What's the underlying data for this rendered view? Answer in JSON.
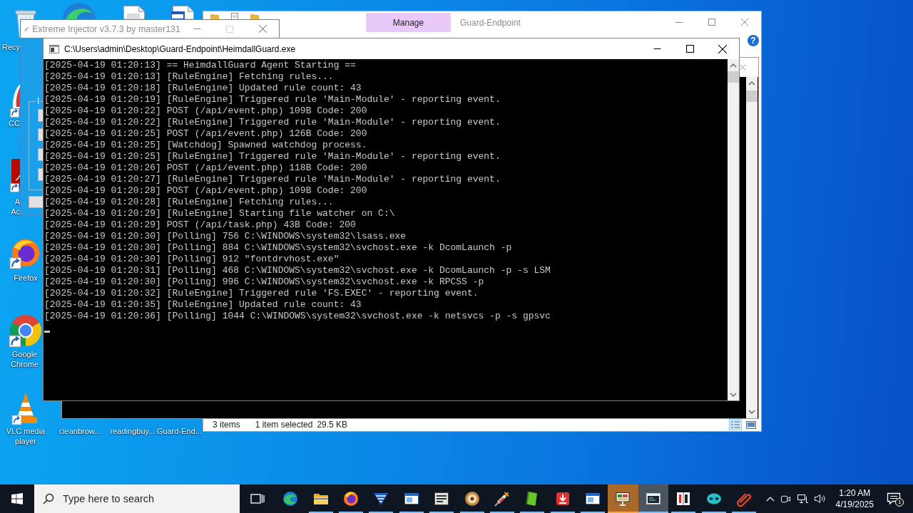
{
  "desktop_icons": [
    {
      "kind": "recycle-bin",
      "label": "Recy"
    },
    {
      "kind": "wave-browser"
    },
    {
      "kind": "document"
    },
    {
      "kind": "document-window"
    },
    {
      "kind": "cloud-app",
      "label": "CC"
    },
    {
      "kind": "pdf-app",
      "label": "A Ac"
    },
    {
      "kind": "fox-browser",
      "label": "Firefox"
    },
    {
      "kind": "ring-browser",
      "label": "Google Chrome"
    },
    {
      "kind": "cone",
      "label": "VLC media player"
    },
    {
      "kind": "covered",
      "label": "cleanbrow..."
    },
    {
      "kind": "covered",
      "label": "readingbuy..."
    },
    {
      "kind": "covered",
      "label": "Guard-End..."
    }
  ],
  "explorer_window": {
    "title": "Guard-Endpoint",
    "active": false,
    "contextual_tab": "Manage",
    "help_button": "?",
    "status_bar": {
      "item_count": "3 items",
      "selection": "1 item selected",
      "size": "29.5 KB"
    },
    "view_buttons": [
      {
        "kind": "details",
        "selected": true
      },
      {
        "kind": "large-icons",
        "selected": false
      }
    ]
  },
  "injector_window": {
    "title": "Extreme Injector v3.7.3 by master131",
    "active": false,
    "maximize_disabled": true,
    "group_label": "I"
  },
  "console_window": {
    "title": "C:\\Users\\admin\\Desktop\\Guard-Endpoint\\HeimdallGuard.exe",
    "active": true,
    "lines": [
      "[2025-04-19 01:20:13] == HeimdallGuard Agent Starting ==",
      "[2025-04-19 01:20:13] [RuleEngine] Fetching rules...",
      "[2025-04-19 01:20:18] [RuleEngine] Updated rule count: 43",
      "[2025-04-19 01:20:19] [RuleEngine] Triggered rule 'Main-Module' - reporting event.",
      "[2025-04-19 01:20:22] POST (/api/event.php) 109B Code: 200",
      "[2025-04-19 01:20:22] [RuleEngine] Triggered rule 'Main-Module' - reporting event.",
      "[2025-04-19 01:20:25] POST (/api/event.php) 126B Code: 200",
      "[2025-04-19 01:20:25] [Watchdog] Spawned watchdog process.",
      "[2025-04-19 01:20:25] [RuleEngine] Triggered rule 'Main-Module' - reporting event.",
      "[2025-04-19 01:20:26] POST (/api/event.php) 118B Code: 200",
      "[2025-04-19 01:20:27] [RuleEngine] Triggered rule 'Main-Module' - reporting event.",
      "[2025-04-19 01:20:28] POST (/api/event.php) 109B Code: 200",
      "[2025-04-19 01:20:28] [RuleEngine] Fetching rules...",
      "[2025-04-19 01:20:29] [RuleEngine] Starting file watcher on C:\\",
      "[2025-04-19 01:20:29] POST (/api/task.php) 43B Code: 200",
      "[2025-04-19 01:20:30] [Polling] 756 C:\\WINDOWS\\system32\\lsass.exe",
      "[2025-04-19 01:20:30] [Polling] 884 C:\\WINDOWS\\system32\\svchost.exe -k DcomLaunch -p",
      "[2025-04-19 01:20:30] [Polling] 912 \"fontdrvhost.exe\"",
      "[2025-04-19 01:20:31] [Polling] 468 C:\\WINDOWS\\system32\\svchost.exe -k DcomLaunch -p -s LSM",
      "[2025-04-19 01:20:30] [Polling] 996 C:\\WINDOWS\\system32\\svchost.exe -k RPCSS -p",
      "[2025-04-19 01:20:32] [RuleEngine] Triggered rule 'FS.EXEC' - reporting event.",
      "[2025-04-19 01:20:35] [RuleEngine] Updated rule count: 43",
      "[2025-04-19 01:20:36] [Polling] 1044 C:\\WINDOWS\\system32\\svchost.exe -k netsvcs -p -s gpsvc"
    ]
  },
  "taskbar": {
    "search": {
      "placeholder": "Type here to search"
    },
    "apps": [
      {
        "kind": "task-view",
        "selected": false,
        "flashing": false,
        "running": false
      },
      {
        "kind": "wave-browser",
        "selected": false,
        "flashing": false,
        "running": false
      },
      {
        "kind": "folder",
        "selected": false,
        "flashing": false,
        "running": true
      },
      {
        "kind": "fox-browser",
        "selected": false,
        "flashing": false,
        "running": true
      },
      {
        "kind": "striped",
        "selected": false,
        "flashing": false,
        "running": true
      },
      {
        "kind": "window",
        "selected": false,
        "flashing": false,
        "running": true
      },
      {
        "kind": "tile",
        "selected": false,
        "flashing": false,
        "running": true
      },
      {
        "kind": "disc",
        "selected": false,
        "flashing": false,
        "running": true
      },
      {
        "kind": "syringe",
        "selected": false,
        "flashing": false,
        "running": true
      },
      {
        "kind": "book",
        "selected": false,
        "flashing": false,
        "running": true
      },
      {
        "kind": "download",
        "selected": false,
        "flashing": false,
        "running": true
      },
      {
        "kind": "window",
        "selected": false,
        "flashing": false,
        "running": true
      },
      {
        "kind": "computer",
        "selected": false,
        "flashing": true,
        "running": true
      },
      {
        "kind": "console",
        "selected": true,
        "flashing": false,
        "running": true
      },
      {
        "kind": "number-tile",
        "selected": false,
        "flashing": false,
        "running": true
      },
      {
        "kind": "mask",
        "selected": false,
        "flashing": false,
        "running": true
      },
      {
        "kind": "paperclip",
        "selected": false,
        "flashing": false,
        "running": true
      }
    ],
    "clock": {
      "time": "1:20 AM",
      "date": "4/19/2025"
    },
    "notification_badge": "1"
  }
}
